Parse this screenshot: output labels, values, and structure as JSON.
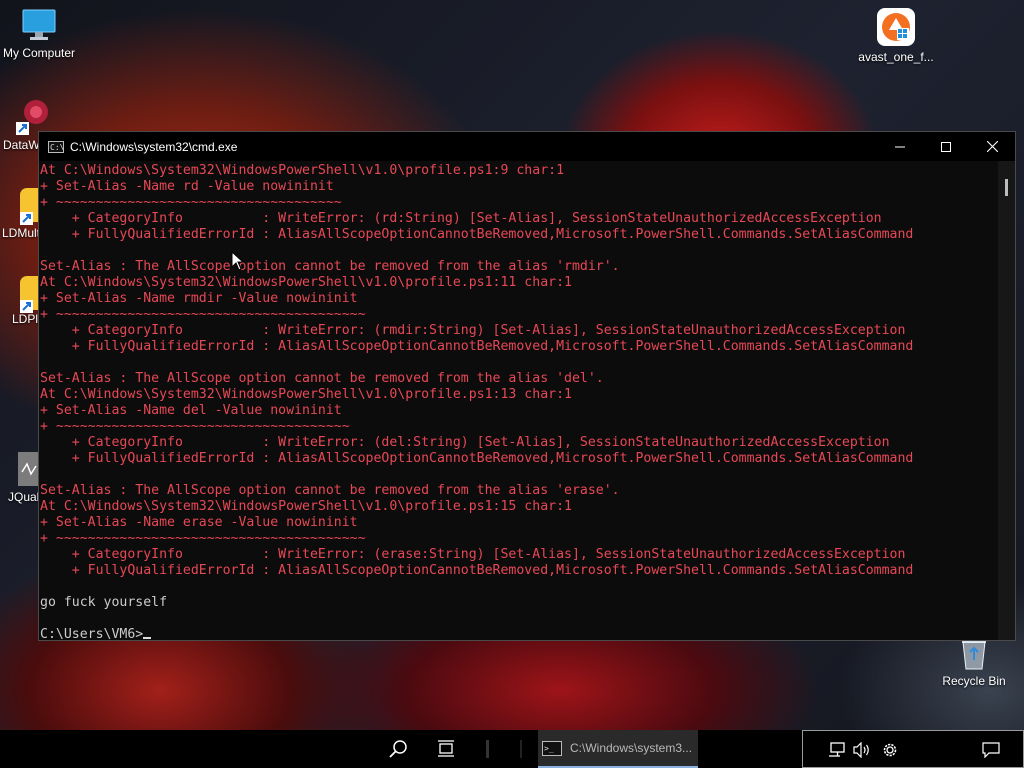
{
  "desktop": {
    "icons": [
      {
        "label": "My Computer",
        "icon": "monitor-icon"
      },
      {
        "label": "DataW",
        "icon": "datawrapper-icon"
      },
      {
        "label": "LDMult",
        "icon": "ldmultiplayer-icon"
      },
      {
        "label": "LDPla",
        "icon": "ldplayer-icon"
      },
      {
        "label": "JQual",
        "icon": "jquality-icon"
      },
      {
        "label": "avast_one_f...",
        "icon": "avast-icon"
      },
      {
        "label": "Recycle Bin",
        "icon": "recycle-bin-icon"
      }
    ]
  },
  "window": {
    "title": "C:\\Windows\\system32\\cmd.exe",
    "minimize_glyph": "─",
    "maximize_glyph": "☐",
    "close_glyph": "✕"
  },
  "console": {
    "lines": [
      {
        "text": "At C:\\Windows\\System32\\WindowsPowerShell\\v1.0\\profile.ps1:9 char:1",
        "style": "err"
      },
      {
        "text": "+ Set-Alias -Name rd -Value nowininit",
        "style": "err"
      },
      {
        "text": "+ ~~~~~~~~~~~~~~~~~~~~~~~~~~~~~~~~~~~~",
        "style": "err"
      },
      {
        "text": "    + CategoryInfo          : WriteError: (rd:String) [Set-Alias], SessionStateUnauthorizedAccessException",
        "style": "err"
      },
      {
        "text": "    + FullyQualifiedErrorId : AliasAllScopeOptionCannotBeRemoved,Microsoft.PowerShell.Commands.SetAliasCommand",
        "style": "err"
      },
      {
        "text": "",
        "style": "err"
      },
      {
        "text": "Set-Alias : The AllScope option cannot be removed from the alias 'rmdir'.",
        "style": "err"
      },
      {
        "text": "At C:\\Windows\\System32\\WindowsPowerShell\\v1.0\\profile.ps1:11 char:1",
        "style": "err"
      },
      {
        "text": "+ Set-Alias -Name rmdir -Value nowininit",
        "style": "err"
      },
      {
        "text": "+ ~~~~~~~~~~~~~~~~~~~~~~~~~~~~~~~~~~~~~~~",
        "style": "err"
      },
      {
        "text": "    + CategoryInfo          : WriteError: (rmdir:String) [Set-Alias], SessionStateUnauthorizedAccessException",
        "style": "err"
      },
      {
        "text": "    + FullyQualifiedErrorId : AliasAllScopeOptionCannotBeRemoved,Microsoft.PowerShell.Commands.SetAliasCommand",
        "style": "err"
      },
      {
        "text": "",
        "style": "err"
      },
      {
        "text": "Set-Alias : The AllScope option cannot be removed from the alias 'del'.",
        "style": "err"
      },
      {
        "text": "At C:\\Windows\\System32\\WindowsPowerShell\\v1.0\\profile.ps1:13 char:1",
        "style": "err"
      },
      {
        "text": "+ Set-Alias -Name del -Value nowininit",
        "style": "err"
      },
      {
        "text": "+ ~~~~~~~~~~~~~~~~~~~~~~~~~~~~~~~~~~~~~",
        "style": "err"
      },
      {
        "text": "    + CategoryInfo          : WriteError: (del:String) [Set-Alias], SessionStateUnauthorizedAccessException",
        "style": "err"
      },
      {
        "text": "    + FullyQualifiedErrorId : AliasAllScopeOptionCannotBeRemoved,Microsoft.PowerShell.Commands.SetAliasCommand",
        "style": "err"
      },
      {
        "text": "",
        "style": "err"
      },
      {
        "text": "Set-Alias : The AllScope option cannot be removed from the alias 'erase'.",
        "style": "err"
      },
      {
        "text": "At C:\\Windows\\System32\\WindowsPowerShell\\v1.0\\profile.ps1:15 char:1",
        "style": "err"
      },
      {
        "text": "+ Set-Alias -Name erase -Value nowininit",
        "style": "err"
      },
      {
        "text": "+ ~~~~~~~~~~~~~~~~~~~~~~~~~~~~~~~~~~~~~~~",
        "style": "err"
      },
      {
        "text": "    + CategoryInfo          : WriteError: (erase:String) [Set-Alias], SessionStateUnauthorizedAccessException",
        "style": "err"
      },
      {
        "text": "    + FullyQualifiedErrorId : AliasAllScopeOptionCannotBeRemoved,Microsoft.PowerShell.Commands.SetAliasCommand",
        "style": "err"
      },
      {
        "text": "",
        "style": "out"
      },
      {
        "text": "go fuck yourself",
        "style": "out"
      },
      {
        "text": "",
        "style": "out"
      }
    ],
    "prompt": "C:\\Users\\VM6>"
  },
  "taskbar": {
    "app_label": "C:\\Windows\\system3...",
    "icons": [
      "search-icon",
      "task-view-icon",
      "network-icon",
      "volume-icon",
      "settings-icon",
      "notification-icon"
    ]
  },
  "colors": {
    "error_text": "#e74856",
    "normal_text": "#cccccc",
    "console_bg": "#0c0c0c",
    "taskbar_bg": "#000000"
  }
}
